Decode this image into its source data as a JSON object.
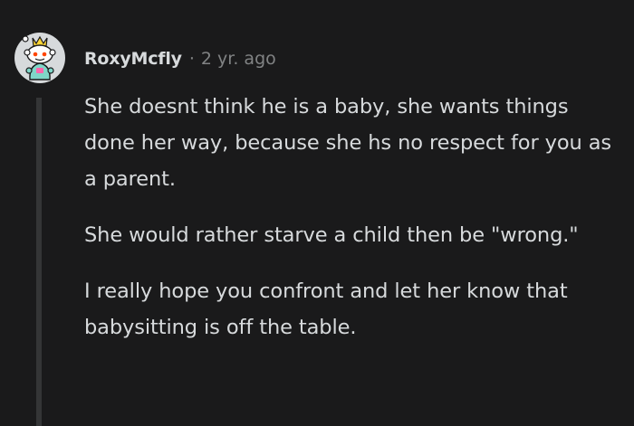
{
  "comment": {
    "author": "RoxyMcfly",
    "separator": "·",
    "age": "2 yr. ago",
    "paragraphs": [
      "She doesnt think he is a baby, she wants things done her way, because she hs no respect for you as a parent.",
      "She would rather starve a child then be \"wrong.\"",
      "I really hope you confront and let her know that babysitting is off the table."
    ]
  },
  "colors": {
    "background": "#1a1a1b",
    "text": "#d7dadc",
    "meta": "#818384",
    "thread_line": "#343536",
    "avatar_background": "#d7dadc",
    "avatar_body": "#7fd6c8",
    "avatar_crown": "#ffd635"
  },
  "icons": {
    "avatar": "snoo-avatar-icon"
  }
}
